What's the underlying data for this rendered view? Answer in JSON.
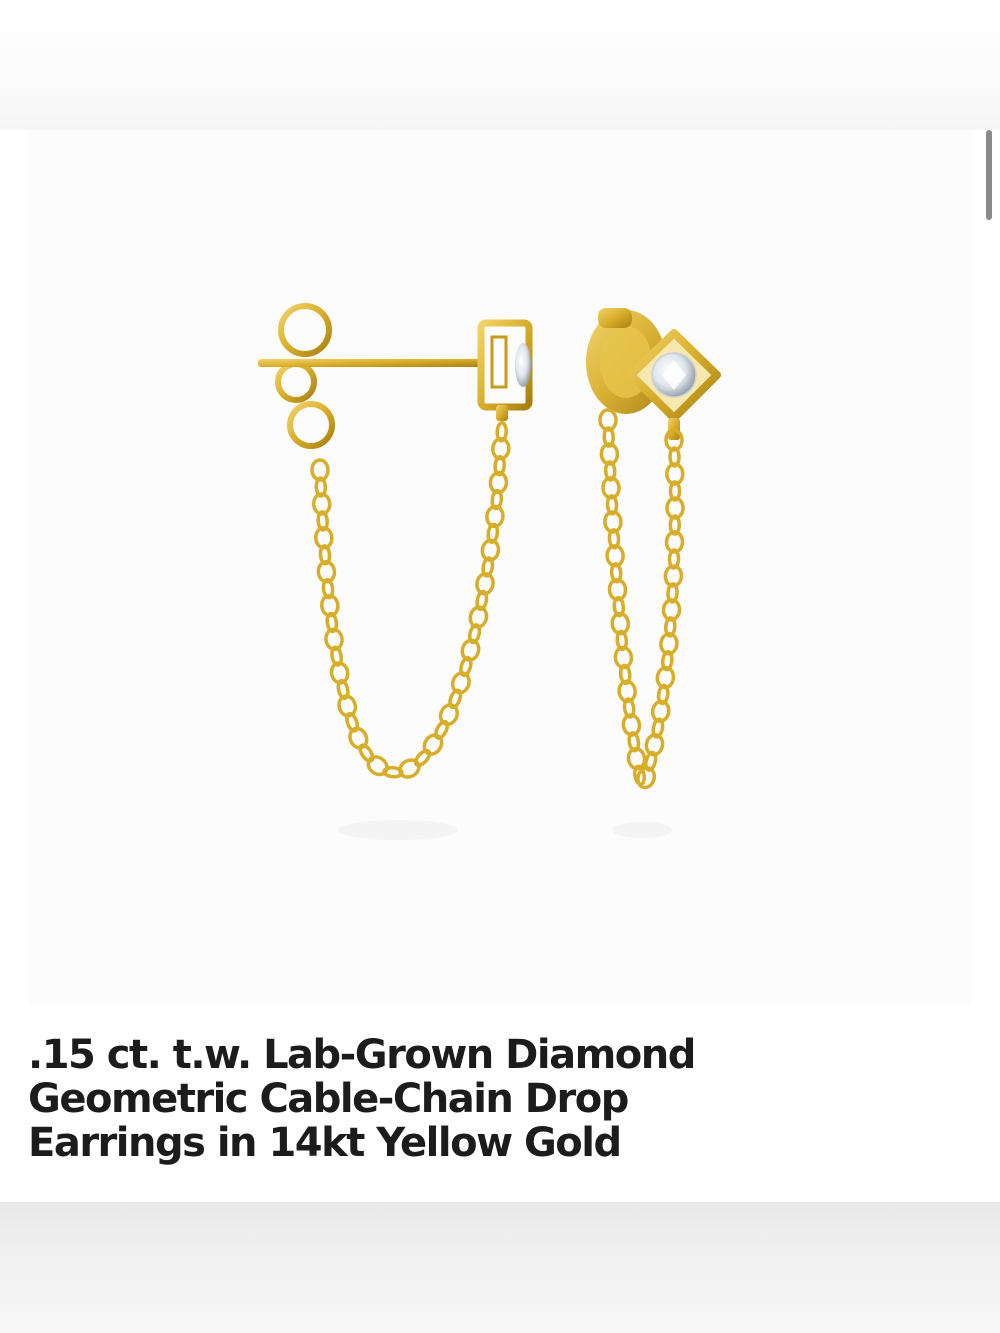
{
  "product": {
    "title_lines": [
      ".15 ct. t.w. Lab-Grown Diamond",
      "Geometric Cable-Chain Drop",
      "Earrings in 14kt Yellow Gold"
    ],
    "image_icon": "chain-drop-earrings-photo"
  },
  "colors": {
    "gold": "#d8ad2a",
    "gold_light": "#f0d46a",
    "gold_dark": "#a87f10",
    "title_text": "#1c1c1c",
    "card_bg": "#fcfcfc"
  }
}
